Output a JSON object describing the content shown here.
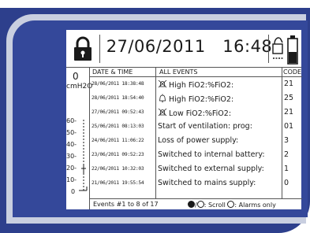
{
  "header": {
    "date": "27/06/2011",
    "time": "16:48"
  },
  "gauge": {
    "zero_label": "0",
    "unit": "cmH2O",
    "ticks": [
      "60-",
      "50-",
      "40-",
      "30-",
      "20-",
      "10-",
      "0"
    ]
  },
  "table": {
    "headers": {
      "date_time": "DATE & TIME",
      "events": "ALL EVENTS",
      "code": "CODE"
    },
    "rows": [
      {
        "date": "28/06/2011",
        "time": "18:38:48",
        "event": "High FiO2:%FiO2:",
        "code": "21",
        "icon": "alarm-muted-icon"
      },
      {
        "date": "28/06/2011",
        "time": "18:54:40",
        "event": "High FiO2:%FiO2:",
        "code": "25",
        "icon": "alarm-bell-icon"
      },
      {
        "date": "27/06/2011",
        "time": "09:52:43",
        "event": "Low FiO2:%FiO2:",
        "code": "21",
        "icon": "alarm-muted-icon"
      },
      {
        "date": "25/06/2011",
        "time": "08:13:03",
        "event": "Start of ventilation: prog:",
        "code": "01",
        "icon": ""
      },
      {
        "date": "24/06/2011",
        "time": "11:06:22",
        "event": "Loss of power supply:",
        "code": "3",
        "icon": ""
      },
      {
        "date": "23/06/2011",
        "time": "09:52:23",
        "event": "Switched to internal battery:",
        "code": "2",
        "icon": ""
      },
      {
        "date": "22/06/2011",
        "time": "10:32:03",
        "event": "Switched to external supply:",
        "code": "1",
        "icon": ""
      },
      {
        "date": "21/06/2011",
        "time": "19:55:54",
        "event": "Switched to mains supply:",
        "code": "0",
        "icon": ""
      }
    ]
  },
  "footer": {
    "range": "Events #1 to 8 of 17",
    "scroll_hint": "/",
    "scroll_label": ": Scroll",
    "alarms_label": ": Alarms only"
  },
  "icons": {
    "lock": "padlock-icon",
    "power": "mains-battery-icon",
    "scroll_up": "scroll-up-icon",
    "scroll_down": "scroll-down-icon",
    "alarms_filter": "alarm-filter-icon"
  },
  "colors": {
    "bezel": "#2d3f8c",
    "bezel_light": "#c9cfe0",
    "screen": "#ffffff"
  }
}
